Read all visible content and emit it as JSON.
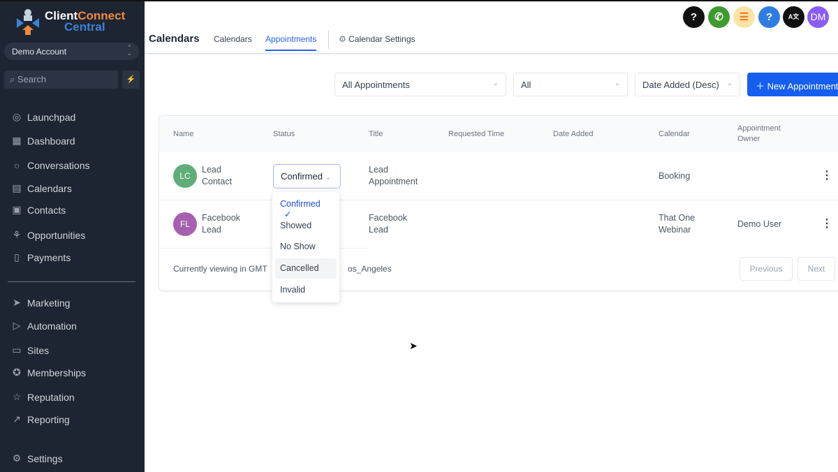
{
  "brand": {
    "line1a": "Client",
    "line1b": "Connect",
    "line2": "Central"
  },
  "sidebar": {
    "account": "Demo Account",
    "search_placeholder": "Search",
    "items": [
      {
        "label": "Launchpad",
        "icon": "rocket-icon"
      },
      {
        "label": "Dashboard",
        "icon": "dashboard-icon"
      },
      {
        "label": "Conversations",
        "icon": "chat-icon"
      },
      {
        "label": "Calendars",
        "icon": "calendar-icon"
      },
      {
        "label": "Contacts",
        "icon": "contacts-icon"
      },
      {
        "label": "Opportunities",
        "icon": "opportunities-icon"
      },
      {
        "label": "Payments",
        "icon": "payments-icon"
      },
      {
        "label": "Marketing",
        "icon": "send-icon"
      },
      {
        "label": "Automation",
        "icon": "automation-icon"
      },
      {
        "label": "Sites",
        "icon": "sites-icon"
      },
      {
        "label": "Memberships",
        "icon": "badge-icon"
      },
      {
        "label": "Reputation",
        "icon": "star-icon"
      },
      {
        "label": "Reporting",
        "icon": "chart-icon"
      },
      {
        "label": "Settings",
        "icon": "gear-icon"
      }
    ]
  },
  "header": {
    "title": "Calendars",
    "tabs": [
      "Calendars",
      "Appointments",
      "Calendar Settings"
    ],
    "active_tab": "Appointments",
    "avatar": "DM"
  },
  "filters": {
    "type": "All Appointments",
    "status": "All",
    "sort": "Date Added (Desc)",
    "new_button": "New Appointment"
  },
  "table": {
    "columns": [
      "Name",
      "Status",
      "Title",
      "Requested Time",
      "Date Added",
      "Calendar",
      "Appointment Owner"
    ],
    "rows": [
      {
        "initials": "LC",
        "color": "#5fae78",
        "name1": "Lead",
        "name2": "Contact",
        "status": "Confirmed",
        "title1": "Lead",
        "title2": "Appointment",
        "requested": "",
        "added": "",
        "calendar1": "Booking",
        "calendar2": "",
        "owner": ""
      },
      {
        "initials": "FL",
        "color": "#a660b0",
        "name1": "Facebook",
        "name2": "Lead",
        "status": "",
        "title1": "Facebook",
        "title2": "Lead",
        "requested": "",
        "added": "",
        "calendar1": "That One",
        "calendar2": "Webinar",
        "owner": "Demo User"
      }
    ],
    "footer_left": "Currently viewing in GMT",
    "footer_right": "os_Angeles",
    "prev": "Previous",
    "next": "Next"
  },
  "status_menu": {
    "options": [
      "Confirmed",
      "Showed",
      "No Show",
      "Cancelled",
      "Invalid"
    ],
    "selected": "Confirmed",
    "hovered": "Cancelled"
  },
  "colors": {
    "accent": "#155eef",
    "sidebar": "#1d2532"
  }
}
